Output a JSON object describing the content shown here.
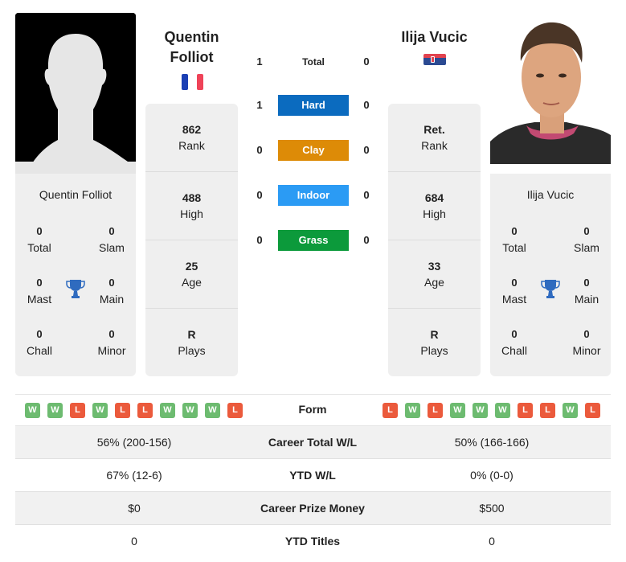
{
  "player_left": {
    "name": "Quentin Folliot",
    "name_line1": "Quentin",
    "name_line2": "Folliot",
    "country_flag": "france-flag",
    "photo": "silhouette-placeholder",
    "titles": {
      "total": {
        "value": "0",
        "label": "Total"
      },
      "slam": {
        "value": "0",
        "label": "Slam"
      },
      "mast": {
        "value": "0",
        "label": "Mast"
      },
      "main": {
        "value": "0",
        "label": "Main"
      },
      "chall": {
        "value": "0",
        "label": "Chall"
      },
      "minor": {
        "value": "0",
        "label": "Minor"
      }
    },
    "info": [
      {
        "value": "862",
        "label": "Rank"
      },
      {
        "value": "488",
        "label": "High"
      },
      {
        "value": "25",
        "label": "Age"
      },
      {
        "value": "R",
        "label": "Plays"
      }
    ],
    "form": [
      "W",
      "W",
      "L",
      "W",
      "L",
      "L",
      "W",
      "W",
      "W",
      "L"
    ]
  },
  "player_right": {
    "name": "Ilija Vucic",
    "country_flag": "serbia-flag",
    "photo": "player-photo",
    "titles": {
      "total": {
        "value": "0",
        "label": "Total"
      },
      "slam": {
        "value": "0",
        "label": "Slam"
      },
      "mast": {
        "value": "0",
        "label": "Mast"
      },
      "main": {
        "value": "0",
        "label": "Main"
      },
      "chall": {
        "value": "0",
        "label": "Chall"
      },
      "minor": {
        "value": "0",
        "label": "Minor"
      }
    },
    "info": [
      {
        "value": "Ret.",
        "label": "Rank"
      },
      {
        "value": "684",
        "label": "High"
      },
      {
        "value": "33",
        "label": "Age"
      },
      {
        "value": "R",
        "label": "Plays"
      }
    ],
    "form": [
      "L",
      "W",
      "L",
      "W",
      "W",
      "W",
      "L",
      "L",
      "W",
      "L"
    ]
  },
  "h2h": [
    {
      "label": "Total",
      "left": "1",
      "right": "0",
      "color": ""
    },
    {
      "label": "Hard",
      "left": "1",
      "right": "0",
      "color": "#0b6bbf"
    },
    {
      "label": "Clay",
      "left": "0",
      "right": "0",
      "color": "#dd8b07"
    },
    {
      "label": "Indoor",
      "left": "0",
      "right": "0",
      "color": "#2b9bf4"
    },
    {
      "label": "Grass",
      "left": "0",
      "right": "0",
      "color": "#0c9a3b"
    }
  ],
  "form_label": "Form",
  "comparison": [
    {
      "left": "56% (200-156)",
      "label": "Career Total W/L",
      "right": "50% (166-166)"
    },
    {
      "left": "67% (12-6)",
      "label": "YTD W/L",
      "right": "0% (0-0)"
    },
    {
      "left": "$0",
      "label": "Career Prize Money",
      "right": "$500"
    },
    {
      "left": "0",
      "label": "YTD Titles",
      "right": "0"
    }
  ],
  "colors": {
    "win": "#6dbb70",
    "loss": "#eb5a3c",
    "trophy": "#2f6bbf"
  }
}
